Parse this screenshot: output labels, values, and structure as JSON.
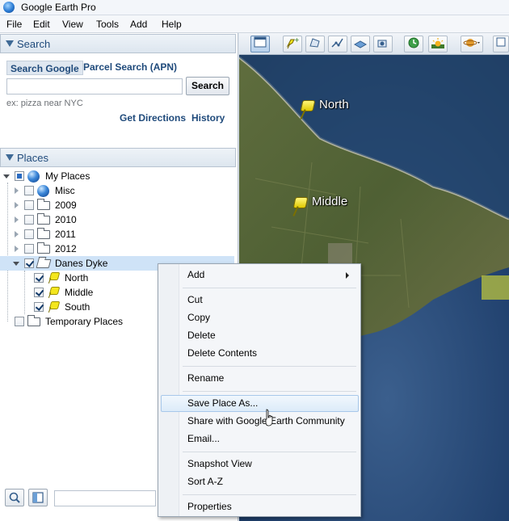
{
  "window": {
    "title": "Google Earth Pro"
  },
  "menu": [
    "File",
    "Edit",
    "View",
    "Tools",
    "Add",
    "Help"
  ],
  "search_panel": {
    "header": "Search",
    "tab_google": "Search Google",
    "tab_parcel": "Parcel Search (APN)",
    "input_value": "",
    "button": "Search",
    "hint": "ex: pizza near NYC",
    "get_directions": "Get Directions",
    "history": "History"
  },
  "places_panel": {
    "header": "Places",
    "items": [
      {
        "label": "My Places",
        "icon": "globe-icon",
        "checked": "partial"
      },
      {
        "label": "Misc",
        "icon": "globe-icon",
        "checked": false
      },
      {
        "label": "2009",
        "icon": "folder-icon",
        "checked": false
      },
      {
        "label": "2010",
        "icon": "folder-icon",
        "checked": false
      },
      {
        "label": "2011",
        "icon": "folder-icon",
        "checked": false
      },
      {
        "label": "2012",
        "icon": "folder-icon",
        "checked": false
      },
      {
        "label": "Danes Dyke",
        "icon": "open-folder-icon",
        "checked": true,
        "selected": true
      },
      {
        "label": "North",
        "icon": "placemark-icon",
        "checked": true
      },
      {
        "label": "Middle",
        "icon": "placemark-icon",
        "checked": true
      },
      {
        "label": "South",
        "icon": "placemark-icon",
        "checked": true
      },
      {
        "label": "Temporary Places",
        "icon": "folder-icon",
        "checked": false
      }
    ]
  },
  "map": {
    "labels": [
      "North",
      "Middle"
    ]
  },
  "context_menu": {
    "items": [
      {
        "label": "Add",
        "submenu": true
      },
      {
        "label": "Cut"
      },
      {
        "label": "Copy"
      },
      {
        "label": "Delete"
      },
      {
        "label": "Delete Contents"
      },
      {
        "label": "Rename"
      },
      {
        "label": "Save Place As...",
        "hovered": true
      },
      {
        "label": "Share with Google Earth Community"
      },
      {
        "label": "Email..."
      },
      {
        "label": "Snapshot View"
      },
      {
        "label": "Sort A-Z"
      },
      {
        "label": "Properties"
      }
    ]
  },
  "colors": {
    "accent_text": "#1f4a7b",
    "selection": "#cfe3f7",
    "menu_hover": "#dcebf9"
  }
}
